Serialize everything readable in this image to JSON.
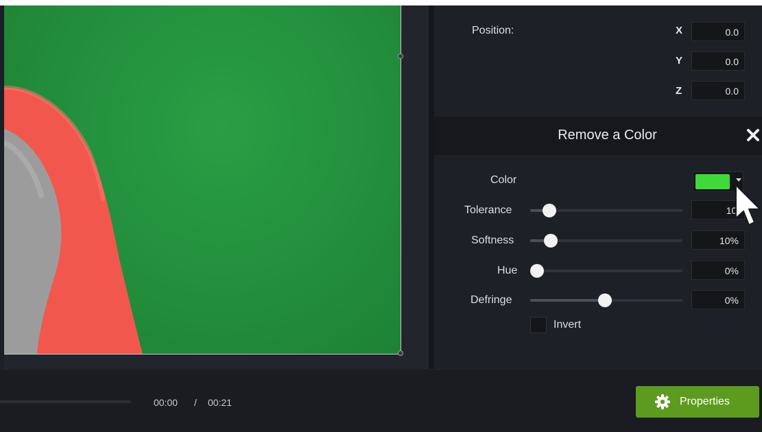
{
  "preview": {
    "background_color": "#23913d"
  },
  "position": {
    "label": "Position:",
    "x": {
      "axis": "X",
      "value": "0.0"
    },
    "y": {
      "axis": "Y",
      "value": "0.0"
    },
    "z": {
      "axis": "Z",
      "value": "0.0"
    }
  },
  "remove_color": {
    "title": "Remove a Color",
    "close_icon": "close-icon",
    "color": {
      "label": "Color",
      "swatch": "#3fd93a"
    },
    "tolerance": {
      "label": "Tolerance",
      "value": "10%",
      "value_shown": "10'",
      "level": 0.1
    },
    "softness": {
      "label": "Softness",
      "value": "10%",
      "level": 0.1
    },
    "hue": {
      "label": "Hue",
      "value": "0%",
      "level": 0.0
    },
    "defringe": {
      "label": "Defringe",
      "value": "0%",
      "level": 0.5
    },
    "invert": {
      "label": "Invert",
      "checked": false
    }
  },
  "playback": {
    "current": "00:00",
    "separator": "/",
    "total": "00:21"
  },
  "properties_button": {
    "label": "Properties",
    "icon": "gear-icon",
    "color": "#5d9b1f"
  }
}
